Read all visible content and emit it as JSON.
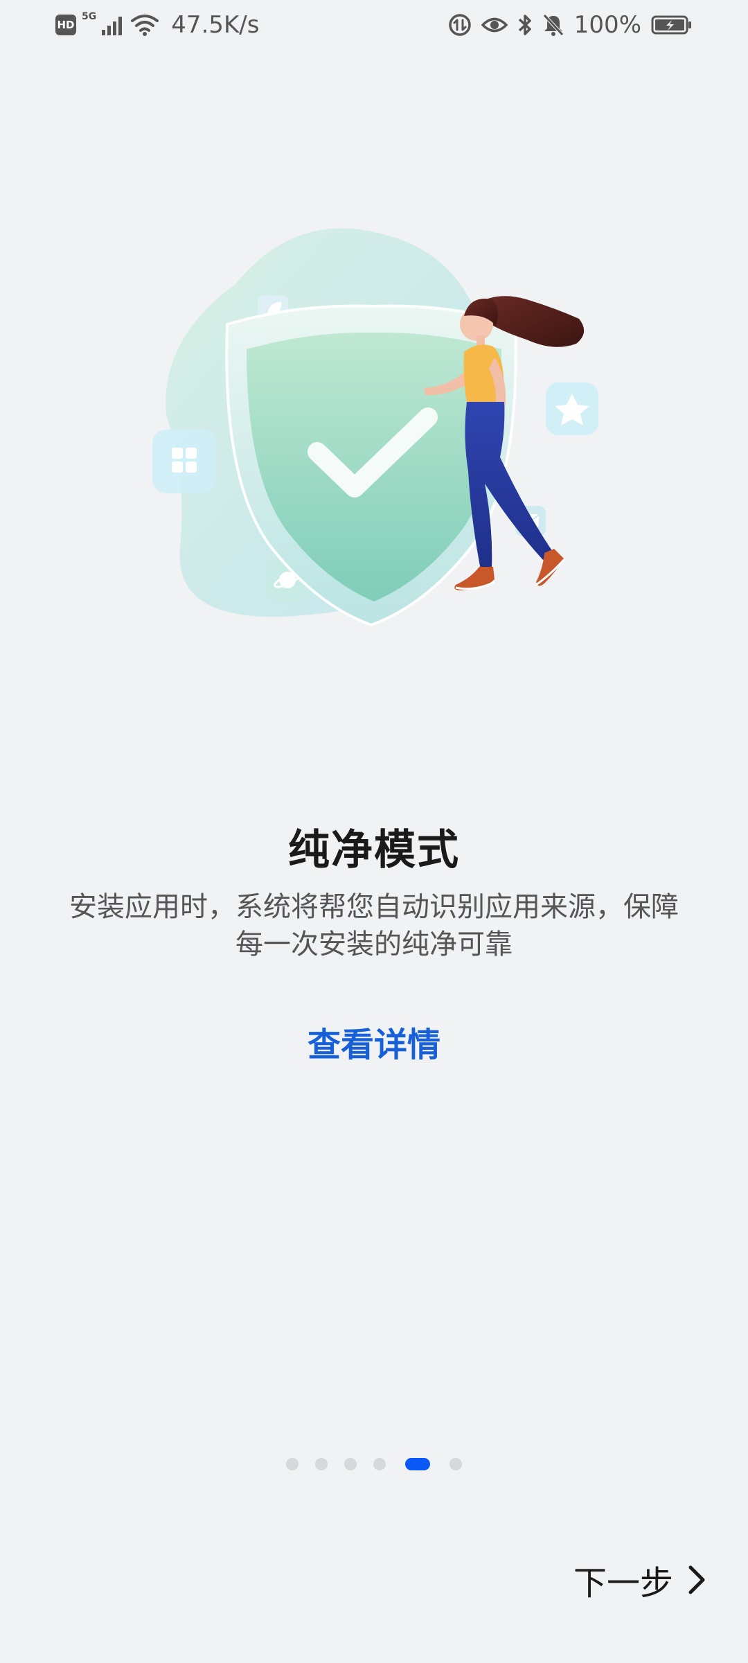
{
  "status_bar": {
    "hd_label": "HD",
    "network_gen": "5G",
    "speed": "47.5K/s",
    "battery": "100%"
  },
  "illustration": {
    "icons": [
      "shield-check-icon",
      "apps-grid-icon",
      "star-icon",
      "mail-icon",
      "planet-icon",
      "leaf-icon"
    ],
    "colors": {
      "shield": "#8ed4bc",
      "blob": "#cdebe1",
      "accent": "#f7b84a"
    }
  },
  "content": {
    "title": "纯净模式",
    "description_line1": "安装应用时，系统将帮您自动识别应用来源，保障",
    "description_line2": "每一次安装的纯净可靠",
    "details_link": "查看详情"
  },
  "pager": {
    "total": 6,
    "current": 5,
    "active_color": "#0a59f7"
  },
  "footer": {
    "next_label": "下一步"
  }
}
